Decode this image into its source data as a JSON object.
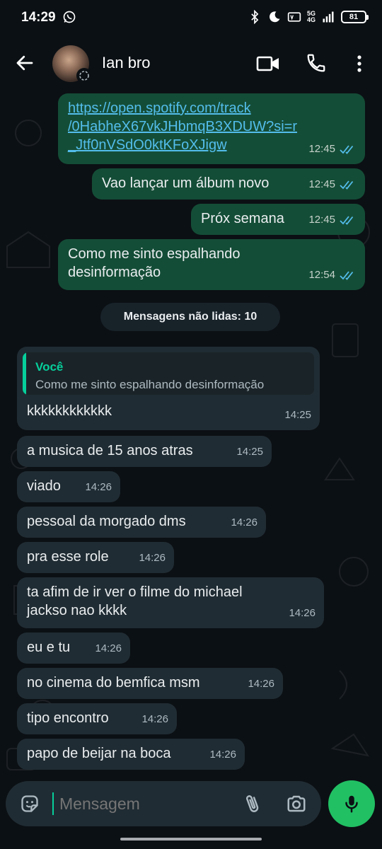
{
  "status_bar": {
    "time": "14:29",
    "network": "5G",
    "network_sub": "4G",
    "battery": "81"
  },
  "header": {
    "contact_name": "Ian bro",
    "icons": [
      "back-arrow-icon",
      "video-call-icon",
      "voice-call-icon",
      "more-options-icon"
    ]
  },
  "messages_out": [
    {
      "text": "https://open.spotify.com/track/0HabheX67vkJHbmqB3XDUW?si=r_Jtf0nVSdO0ktKFoXJigw",
      "lines": [
        "https://open.spotify.com/track",
        "/0HabheX67vkJHbmqB3XDUW?si=r",
        "_Jtf0nVSdO0ktKFoXJigw"
      ],
      "time": "12:45",
      "status": "read"
    },
    {
      "text": "Vao lançar um álbum novo",
      "time": "12:45",
      "status": "read"
    },
    {
      "text": "Próx semana",
      "time": "12:45",
      "status": "read"
    },
    {
      "text": "Como me sinto espalhando desinformação",
      "lines": [
        "Como me sinto espalhando",
        "desinformação"
      ],
      "time": "12:54",
      "status": "read"
    }
  ],
  "unread_divider": "Mensagens não lidas: 10",
  "reply_quote": {
    "author": "Você",
    "text": "Como me sinto espalhando desinformação"
  },
  "messages_in": [
    {
      "text": "kkkkkkkkkkkk",
      "time": "14:25"
    },
    {
      "text": "a musica de 15 anos atras",
      "time": "14:25"
    },
    {
      "text": "viado",
      "time": "14:26"
    },
    {
      "text": "pessoal da morgado dms",
      "time": "14:26"
    },
    {
      "text": "pra esse role",
      "time": "14:26"
    },
    {
      "text": "ta afim de ir ver o filme do michael jackso nao kkkk",
      "lines": [
        "ta afim de ir ver o filme do michael",
        "jackso nao kkkk"
      ],
      "time": "14:26"
    },
    {
      "text": "eu e tu",
      "time": "14:26"
    },
    {
      "text": "no cinema do bemfica msm",
      "time": "14:26"
    },
    {
      "text": "tipo encontro",
      "time": "14:26"
    },
    {
      "text": "papo de beijar na boca",
      "time": "14:26"
    }
  ],
  "composer": {
    "placeholder": "Mensagem",
    "icons": [
      "emoji-sticker-icon",
      "attach-icon",
      "camera-icon",
      "mic-icon"
    ]
  },
  "colors": {
    "background": "#0b1014",
    "outgoing_bubble": "#144d37",
    "incoming_bubble": "#202c33",
    "link": "#53bdeb",
    "accent": "#21c063",
    "read_ticks": "#53bdeb"
  }
}
